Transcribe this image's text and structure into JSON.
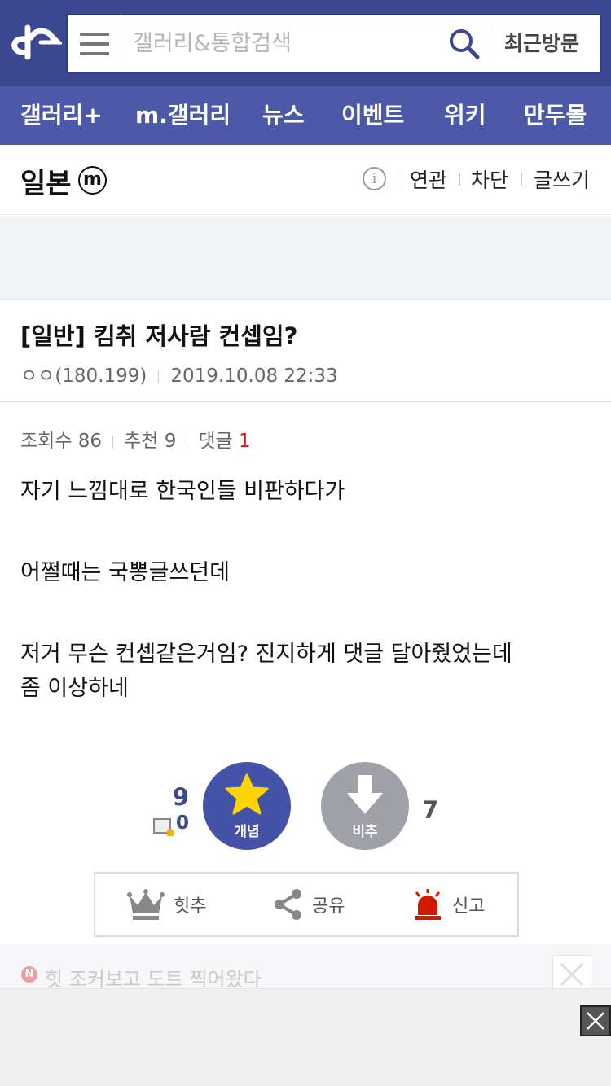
{
  "header": {
    "logo": "dc-logo",
    "search_placeholder": "갤러리&통합검색",
    "recent_label": "최근방문"
  },
  "gnb": {
    "items": [
      "갤러리+",
      "m.갤러리",
      "뉴스",
      "이벤트",
      "위키",
      "만두몰"
    ]
  },
  "gallery": {
    "title": "일본",
    "badge": "ⓜ",
    "links": {
      "related": "연관",
      "block": "차단",
      "write": "글쓰기"
    }
  },
  "post": {
    "title": "[일반] 킴취 저사람 컨셉임?",
    "author": "ㅇㅇ(180.199)",
    "date": "2019.10.08 22:33",
    "stats": {
      "views_label": "조회수",
      "views": "86",
      "recommend_label": "추천",
      "recommend": "9",
      "comments_label": "댓글",
      "comments": "1"
    },
    "body": [
      "자기 느낌대로 한국인들 비판하다가",
      "어쩔때는 국뽕글쓰던데",
      "저거 무슨 컨셉같은거임? 진지하게 댓글 달아줬었는데",
      "좀 이상하네"
    ]
  },
  "votes": {
    "up_count": "9",
    "fix_count": "0",
    "up_label": "개념",
    "down_label": "비추",
    "down_count": "7"
  },
  "actions": {
    "hit": "힛추",
    "share": "공유",
    "report": "신고"
  },
  "notice": {
    "icon": "N",
    "text": "힛  조커보고 도트 찍어왔다"
  },
  "colors": {
    "topbar": "#3b4890",
    "gnb": "#4b59a8",
    "accent": "#4452a8",
    "report_red": "#d31900",
    "star_yellow": "#ffd400"
  }
}
